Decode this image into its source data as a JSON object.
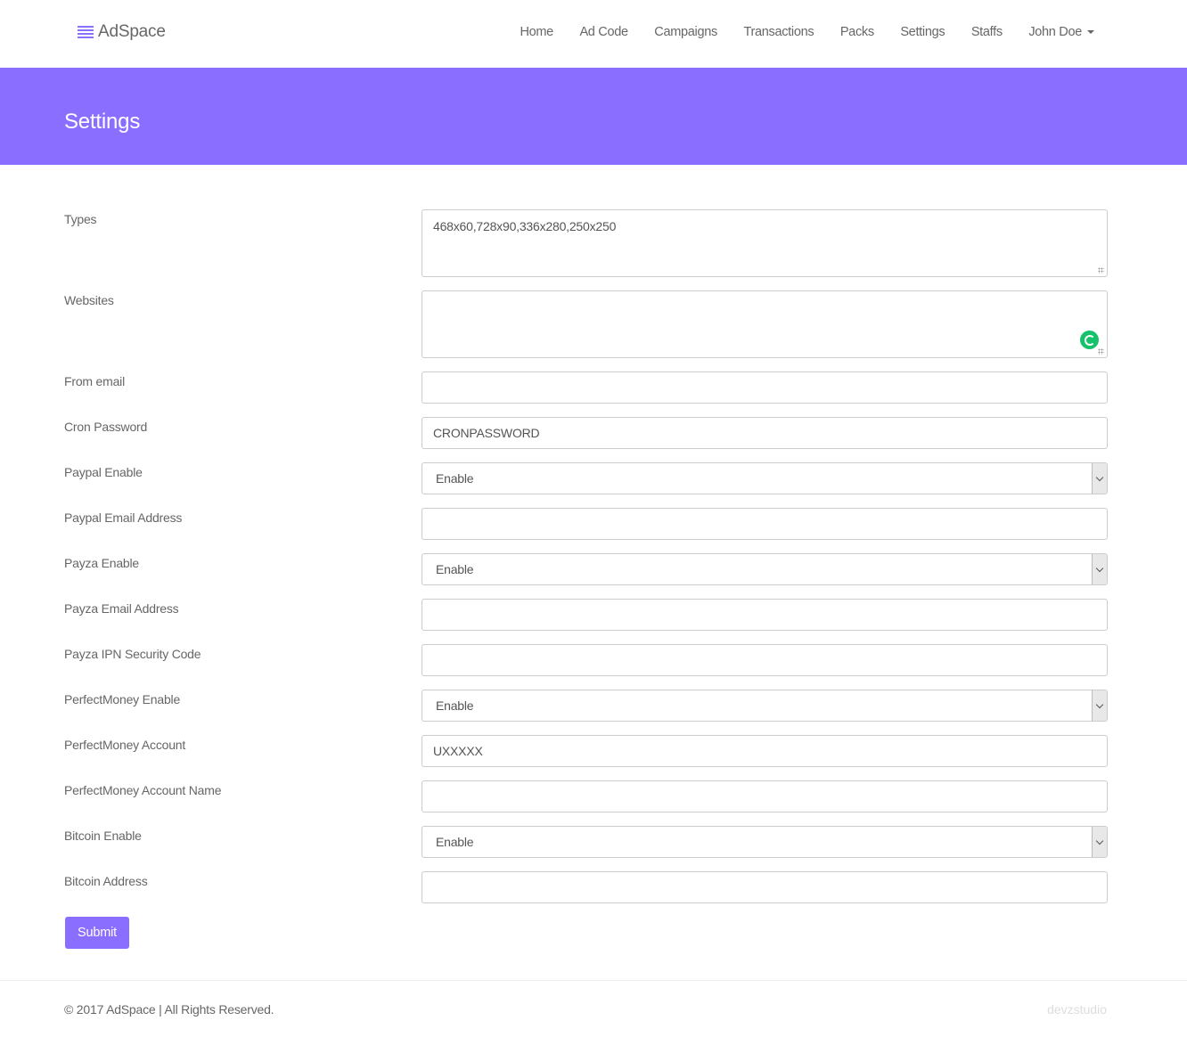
{
  "brand": {
    "name": "AdSpace",
    "icon": "bars-icon",
    "color": "#8a6eff"
  },
  "nav": {
    "items": [
      "Home",
      "Ad Code",
      "Campaigns",
      "Transactions",
      "Packs",
      "Settings",
      "Staffs"
    ],
    "user": "John Doe"
  },
  "page": {
    "title": "Settings",
    "header_color": "#8a6eff"
  },
  "form": {
    "fields": [
      {
        "label": "Types",
        "type": "textarea",
        "value": "468x60,728x90,336x280,250x250"
      },
      {
        "label": "Websites",
        "type": "textarea",
        "value": ""
      },
      {
        "label": "From email",
        "type": "input",
        "value": ""
      },
      {
        "label": "Cron Password",
        "type": "input",
        "value": "CRONPASSWORD"
      },
      {
        "label": "Paypal Enable",
        "type": "select",
        "value": "Enable"
      },
      {
        "label": "Paypal Email Address",
        "type": "input",
        "value": ""
      },
      {
        "label": "Payza Enable",
        "type": "select",
        "value": "Enable"
      },
      {
        "label": "Payza Email Address",
        "type": "input",
        "value": ""
      },
      {
        "label": "Payza IPN Security Code",
        "type": "input",
        "value": ""
      },
      {
        "label": "PerfectMoney Enable",
        "type": "select",
        "value": "Enable"
      },
      {
        "label": "PerfectMoney Account",
        "type": "input",
        "value": "UXXXXX"
      },
      {
        "label": "PerfectMoney Account Name",
        "type": "input",
        "value": ""
      },
      {
        "label": "Bitcoin Enable",
        "type": "select",
        "value": "Enable"
      },
      {
        "label": "Bitcoin Address",
        "type": "input",
        "value": ""
      }
    ],
    "submit_label": "Submit"
  },
  "footer": {
    "copyright": "© 2017 AdSpace | All Rights Reserved.",
    "credit": "devzstudio"
  }
}
